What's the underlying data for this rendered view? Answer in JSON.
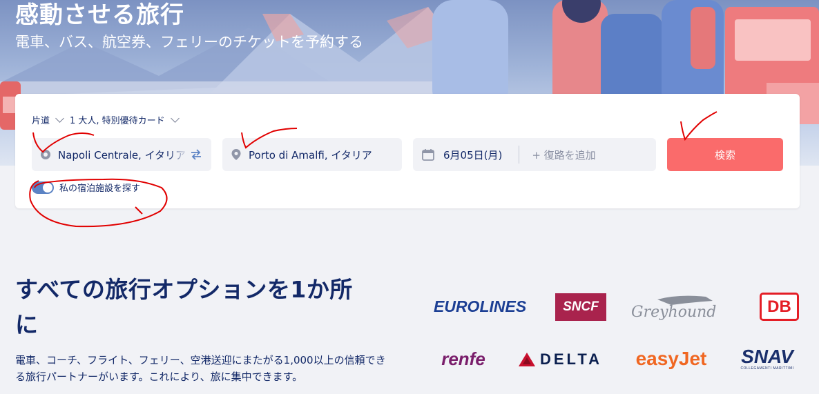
{
  "hero": {
    "title": "感動させる旅行",
    "subtitle": "電車、バス、航空券、フェリーのチケットを予約する"
  },
  "search": {
    "trip_type": "片道",
    "passengers": "1 大人, 特別優待カード",
    "from": "Napoli Centrale, イタリア",
    "to": "Porto di Amalfi, イタリア",
    "date": "6月05日(月)",
    "return_placeholder": "+ 復路を追加",
    "search_button": "検索",
    "accommodation_toggle_label": "私の宿泊施設を探す",
    "accommodation_toggle_on": true
  },
  "section": {
    "heading": "すべての旅行オプションを1か所に",
    "description": "電車、コーチ、フライト、フェリー、空港送迎にまたがる1,000以上の信頼できる旅行パートナーがいます。これにより、旅に集中できます。"
  },
  "partners": [
    {
      "name": "eurolines",
      "text": "EUROLINES"
    },
    {
      "name": "sncf",
      "text": "SNCF"
    },
    {
      "name": "greyhound",
      "text": "Greyhound"
    },
    {
      "name": "db",
      "text": "DB"
    },
    {
      "name": "renfe",
      "text": "renfe"
    },
    {
      "name": "delta",
      "text": "DELTA"
    },
    {
      "name": "easyjet",
      "text": "easyJet"
    },
    {
      "name": "snav",
      "text": "SNAV",
      "tagline": "COLLEGAMENTI MARITTIMI"
    }
  ],
  "colors": {
    "brand_navy": "#132968",
    "search_button": "#fa6b6b",
    "toggle": "#5b83c4",
    "annotation_red": "#e10000"
  }
}
